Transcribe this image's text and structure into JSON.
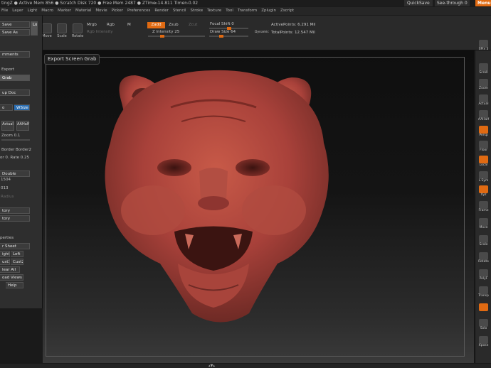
{
  "title_bar": {
    "text": "tingZ ● Active Mem 856 ● Scratch Disk 720 ● Free Mem 2487 ● ZTime▹14.811 Timer▹0.02",
    "quicksave": "QuickSave",
    "see_through": "See-through 0",
    "menus": "Menus"
  },
  "menu_bar": {
    "items": [
      "File",
      "Layer",
      "Light",
      "Macro",
      "Marker",
      "Material",
      "Movie",
      "Picker",
      "Preferences",
      "Render",
      "Stencil",
      "Stroke",
      "Texture",
      "Tool",
      "Transform",
      "Zplugin",
      "Zscript"
    ]
  },
  "top_shelf": {
    "tools": [
      {
        "label": "Move"
      },
      {
        "label": "Scale"
      },
      {
        "label": "Rotate"
      }
    ],
    "mrgb": "Mrgb",
    "rgb": "Rgb",
    "m": "M",
    "rgb_intensity": "Rgb Intensity",
    "zadd": "Zadd",
    "zsub": "Zsub",
    "zcut": "Zcut",
    "z_intensity": "Z Intensity 25",
    "focal_shift": "Focal Shift 0",
    "draw_size": "Draw Size 64",
    "dynamic": "Dynamic",
    "active_points": "ActivePoints: 6.291 Mil",
    "total_points": "TotalPoints: 12.547 Mil",
    "z_intensity_level": 0.25,
    "draw_size_level": 0.3,
    "focal_level": 0.5
  },
  "left_panel": {
    "save": "Save",
    "save_as": "Save As",
    "load": "Lo",
    "comments": "mments",
    "export": "Export",
    "grab": "Grab",
    "setup_doc": "up Doc",
    "o": "o",
    "wsize": "WSize",
    "actual": "Actual",
    "aahalf": "AAHalf",
    "zoom": "Zoom 0.1",
    "border": "Border",
    "border2": "Border2",
    "ratio": "or 0. Rate 0.25",
    "double": "Double",
    "val1": "1504",
    "val2": "013",
    "radius": "Radius",
    "history": "tory",
    "history2": "tory",
    "properties": "perties",
    "sheet": "r Sheet",
    "right": "ight",
    "left": "Left",
    "cust1": "ust1",
    "cust2": "Cust2",
    "clear_all": "lear All",
    "load_views": "oad Views",
    "help": "Help"
  },
  "viewport": {
    "tooltip": "Export Screen Grab",
    "model": "sculpted tiger head"
  },
  "right_panel": {
    "items": [
      "SPix 3",
      "Scroll",
      "Zoom",
      "Actual",
      "AAHalf",
      "Persp",
      "Floor",
      "Local",
      "L.Sym",
      "Xyz",
      "Frame",
      "Move",
      "Scale",
      "Rotate",
      "PolyF",
      "Transp",
      "Solo",
      "Xpose"
    ]
  },
  "bottom_bar": {
    "text": "▴▼▴"
  },
  "colors": {
    "accent": "#e06a12",
    "clay": "#b6473a"
  }
}
